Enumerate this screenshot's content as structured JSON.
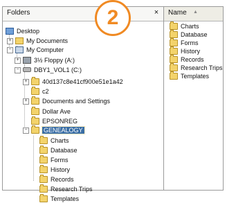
{
  "badge": {
    "number": "2",
    "color": "#f08a23"
  },
  "folders_pane": {
    "title": "Folders",
    "close": "×",
    "tree": {
      "desktop": "Desktop",
      "my_documents": "My Documents",
      "my_computer": "My Computer",
      "floppy": "3½ Floppy (A:)",
      "drive_c": "DBY1_VOL1 (C:)",
      "hash_folder": "40d137c8e41cf900e51e1a42",
      "c2": "c2",
      "docs_settings": "Documents and Settings",
      "dollar_ave": "Dollar Ave",
      "epsonreg": "EPSONREG",
      "genealogy": "GENEALOGY",
      "genealogy_children": [
        "Charts",
        "Database",
        "Forms",
        "History",
        "Records",
        "Research Trips",
        "Templates"
      ]
    }
  },
  "list_pane": {
    "column_name": "Name",
    "sort_icon": "sort-ascending-icon",
    "items": [
      "Charts",
      "Database",
      "Forms",
      "History",
      "Records",
      "Research Trips",
      "Templates"
    ]
  },
  "colors": {
    "selection": "#3a6ea5",
    "folder": "#f3d36b"
  }
}
